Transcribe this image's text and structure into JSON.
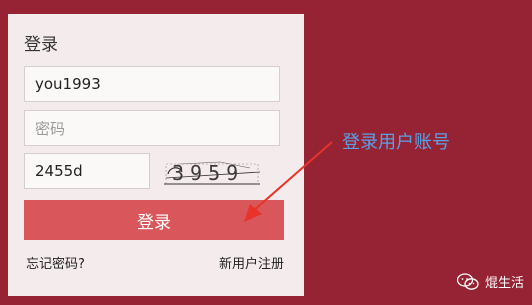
{
  "login": {
    "title": "登录",
    "username_value": "you1993",
    "password_placeholder": "密码",
    "captcha_value": "2455d",
    "captcha_image_text": "3959",
    "submit_label": "登录",
    "forgot_password": "忘记密码?",
    "register": "新用户注册"
  },
  "annotation": {
    "text": "登录用户账号",
    "color": "#5aa0e8",
    "arrow_color": "#e8332b"
  },
  "watermark": {
    "text": "焜生活",
    "icon": "wechat-icon"
  },
  "colors": {
    "background": "#962333",
    "panel": "#f4ecec",
    "button": "#d9575a"
  }
}
